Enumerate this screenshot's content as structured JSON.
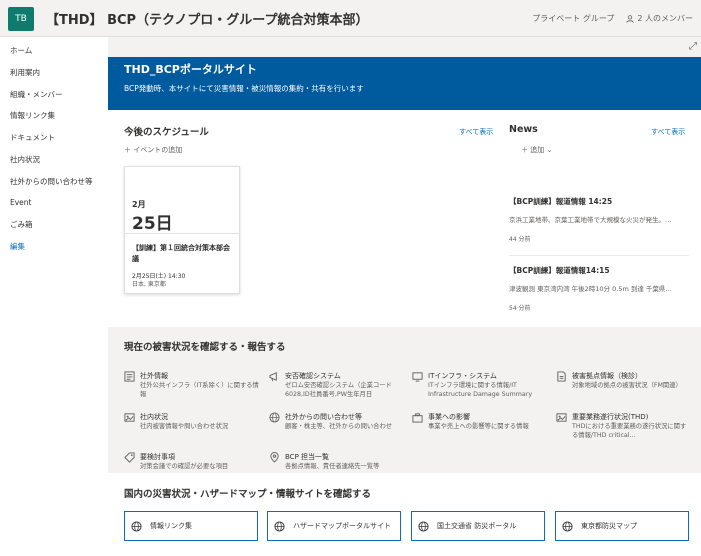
{
  "header": {
    "logo_text": "TB",
    "site_title": "【THD】 BCP（テクノプロ・グループ統合対策本部）",
    "group_type": "プライベート グループ",
    "members": "2 人のメンバー"
  },
  "sidebar": {
    "items": [
      {
        "label": "ホーム"
      },
      {
        "label": "利用案内"
      },
      {
        "label": "組織・メンバー"
      },
      {
        "label": "情報リンク集"
      },
      {
        "label": "ドキュメント"
      },
      {
        "label": "社内状況"
      },
      {
        "label": "社外からの問い合わせ等"
      },
      {
        "label": "Event"
      },
      {
        "label": "ごみ箱"
      },
      {
        "label": "編集"
      }
    ]
  },
  "hero": {
    "title": "THD_BCPポータルサイト",
    "subtitle": "BCP発動時、本サイトにて災害情報・被災情報の集約・共有を行います"
  },
  "schedule": {
    "heading": "今後のスケジュール",
    "see_all": "すべて表示",
    "add_event": "イベントの追加",
    "event": {
      "month": "2月",
      "day": "25日",
      "title": "【訓練】第１回統合対策本部会議",
      "time": "2月25日(土) 14:30",
      "location": "日本, 東京都"
    }
  },
  "news": {
    "heading": "News",
    "see_all": "すべて表示",
    "add": "追加",
    "items": [
      {
        "title": "【BCP訓練】報道情報 14:25",
        "snippet": "京浜工業地帯、京葉工業地帯で大規模な火災が発生。…",
        "views": "44 分前"
      },
      {
        "title": "【BCP訓練】報道情報14:15",
        "snippet": "津波観測 東京湾内湾 午後2時10分 0.5m 到達 千葉県…",
        "views": "54 分前"
      }
    ]
  },
  "status": {
    "heading": "現在の被害状況を確認する・報告する",
    "links": [
      {
        "title": "社外情報",
        "desc": "社外公共インフラ（IT系除く）に関する情報"
      },
      {
        "title": "安否確認システム",
        "desc": "ゼロム安否確認システム（企業コード6028,ID社員番号,PW生年月日"
      },
      {
        "title": "ITインフラ・システム",
        "desc": "ITインフラ環境に関する情報/IT Infrastructure Damage Summary"
      },
      {
        "title": "被害拠点情報（検診）",
        "desc": "対象地域の拠点の被害状況（FM関連）"
      },
      {
        "title": "社内状況",
        "desc": "社内被害情報や問い合わせ状況"
      },
      {
        "title": "社外からの問い合わせ等",
        "desc": "顧客・株主等、社外からの問い合わせ"
      },
      {
        "title": "事業への影響",
        "desc": "事業や売上への影響等に関する情報"
      },
      {
        "title": "重要業務遂行状況(THD)",
        "desc": "THDにおける重要業務の遂行状況に関する情報/THD critical…"
      },
      {
        "title": "要検討事項",
        "desc": "対策会議での確認が必要な項目"
      },
      {
        "title": "BCP 担当一覧",
        "desc": "各拠点情報、責任者連絡先一覧等"
      }
    ]
  },
  "sites": {
    "heading": "国内の災害状況・ハザードマップ・情報サイトを確認する",
    "buttons": [
      {
        "label": "情報リンク集"
      },
      {
        "label": "ハザードマップポータルサイト"
      },
      {
        "label": "国土交通省 防災ポータル"
      },
      {
        "label": "東京都防災マップ"
      }
    ]
  },
  "colors": {
    "accent": "#0f6cbd",
    "hero": "#005a9e",
    "logo": "#0f7b6c"
  }
}
